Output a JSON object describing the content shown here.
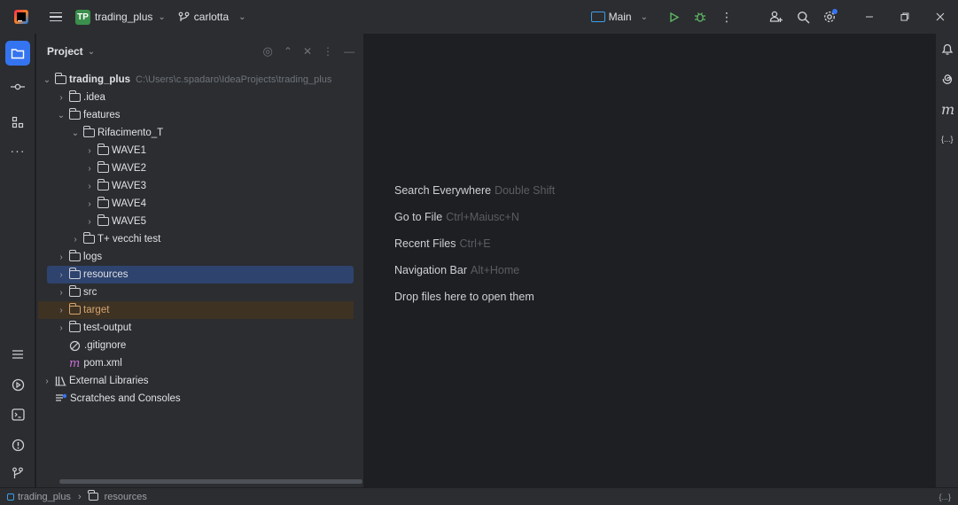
{
  "titlebar": {
    "project_badge": "TP",
    "project_name": "trading_plus",
    "branch_name": "carlotta",
    "run_config": "Main"
  },
  "project_panel": {
    "title": "Project",
    "tree": [
      {
        "label": "trading_plus",
        "path": "C:\\Users\\c.spadaro\\IdeaProjects\\trading_plus",
        "arrow": "⌄",
        "level": 0
      },
      {
        "label": ".idea",
        "arrow": "›",
        "level": 1
      },
      {
        "label": "features",
        "arrow": "⌄",
        "level": 1
      },
      {
        "label": "Rifacimento_T",
        "arrow": "⌄",
        "level": 2
      },
      {
        "label": "WAVE1",
        "arrow": "›",
        "level": 3
      },
      {
        "label": "WAVE2",
        "arrow": "›",
        "level": 3
      },
      {
        "label": "WAVE3",
        "arrow": "›",
        "level": 3
      },
      {
        "label": "WAVE4",
        "arrow": "›",
        "level": 3
      },
      {
        "label": "WAVE5",
        "arrow": "›",
        "level": 3
      },
      {
        "label": "T+ vecchi test",
        "arrow": "›",
        "level": 2
      },
      {
        "label": "logs",
        "arrow": "›",
        "level": 1
      },
      {
        "label": "resources",
        "arrow": "›",
        "level": 1,
        "state": "selected"
      },
      {
        "label": "src",
        "arrow": "›",
        "level": 1
      },
      {
        "label": "target",
        "arrow": "›",
        "level": 1,
        "state": "excluded"
      },
      {
        "label": "test-output",
        "arrow": "›",
        "level": 1
      },
      {
        "label": ".gitignore",
        "level": 1
      },
      {
        "label": "pom.xml",
        "level": 1
      },
      {
        "label": "External Libraries",
        "arrow": "›",
        "level": 0
      },
      {
        "label": "Scratches and Consoles",
        "level": 0
      }
    ]
  },
  "editor": {
    "hints": [
      {
        "label": "Search Everywhere",
        "key": "Double Shift"
      },
      {
        "label": "Go to File",
        "key": "Ctrl+Maiusc+N"
      },
      {
        "label": "Recent Files",
        "key": "Ctrl+E"
      },
      {
        "label": "Navigation Bar",
        "key": "Alt+Home"
      },
      {
        "label": "Drop files here to open them",
        "key": ""
      }
    ]
  },
  "statusbar": {
    "crumb_project": "trading_plus",
    "crumb_separator": "›",
    "crumb_folder": "resources",
    "right_label": "{...}"
  },
  "right_strip": {
    "json_label": "{...}",
    "maven_label": "m"
  },
  "colors": {
    "accent": "#3574f0",
    "selection": "#2e436e",
    "excluded_bg": "#3e3223",
    "excluded_text": "#d5a56f",
    "project_badge": "#3b8f4c"
  }
}
